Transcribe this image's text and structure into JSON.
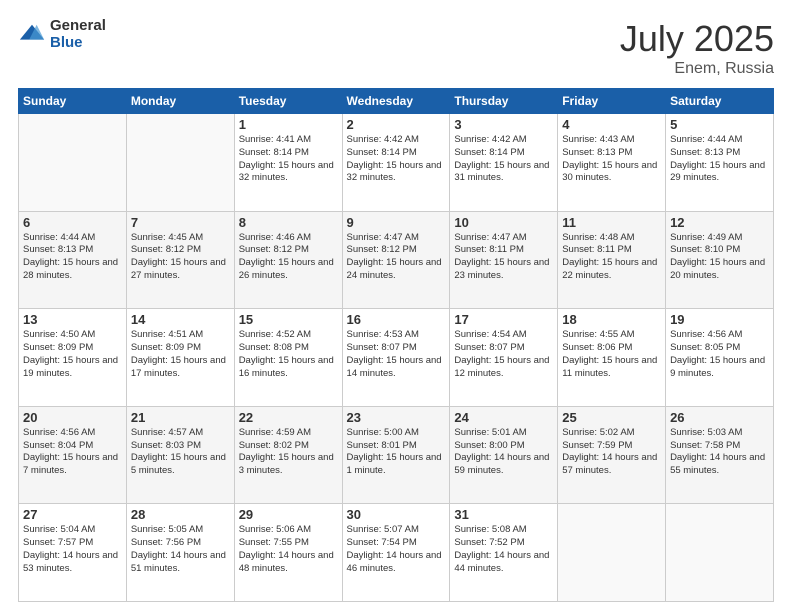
{
  "header": {
    "logo_general": "General",
    "logo_blue": "Blue",
    "month_title": "July 2025",
    "location": "Enem, Russia"
  },
  "weekdays": [
    "Sunday",
    "Monday",
    "Tuesday",
    "Wednesday",
    "Thursday",
    "Friday",
    "Saturday"
  ],
  "weeks": [
    [
      {
        "day": "",
        "info": ""
      },
      {
        "day": "",
        "info": ""
      },
      {
        "day": "1",
        "info": "Sunrise: 4:41 AM\nSunset: 8:14 PM\nDaylight: 15 hours\nand 32 minutes."
      },
      {
        "day": "2",
        "info": "Sunrise: 4:42 AM\nSunset: 8:14 PM\nDaylight: 15 hours\nand 32 minutes."
      },
      {
        "day": "3",
        "info": "Sunrise: 4:42 AM\nSunset: 8:14 PM\nDaylight: 15 hours\nand 31 minutes."
      },
      {
        "day": "4",
        "info": "Sunrise: 4:43 AM\nSunset: 8:13 PM\nDaylight: 15 hours\nand 30 minutes."
      },
      {
        "day": "5",
        "info": "Sunrise: 4:44 AM\nSunset: 8:13 PM\nDaylight: 15 hours\nand 29 minutes."
      }
    ],
    [
      {
        "day": "6",
        "info": "Sunrise: 4:44 AM\nSunset: 8:13 PM\nDaylight: 15 hours\nand 28 minutes."
      },
      {
        "day": "7",
        "info": "Sunrise: 4:45 AM\nSunset: 8:12 PM\nDaylight: 15 hours\nand 27 minutes."
      },
      {
        "day": "8",
        "info": "Sunrise: 4:46 AM\nSunset: 8:12 PM\nDaylight: 15 hours\nand 26 minutes."
      },
      {
        "day": "9",
        "info": "Sunrise: 4:47 AM\nSunset: 8:12 PM\nDaylight: 15 hours\nand 24 minutes."
      },
      {
        "day": "10",
        "info": "Sunrise: 4:47 AM\nSunset: 8:11 PM\nDaylight: 15 hours\nand 23 minutes."
      },
      {
        "day": "11",
        "info": "Sunrise: 4:48 AM\nSunset: 8:11 PM\nDaylight: 15 hours\nand 22 minutes."
      },
      {
        "day": "12",
        "info": "Sunrise: 4:49 AM\nSunset: 8:10 PM\nDaylight: 15 hours\nand 20 minutes."
      }
    ],
    [
      {
        "day": "13",
        "info": "Sunrise: 4:50 AM\nSunset: 8:09 PM\nDaylight: 15 hours\nand 19 minutes."
      },
      {
        "day": "14",
        "info": "Sunrise: 4:51 AM\nSunset: 8:09 PM\nDaylight: 15 hours\nand 17 minutes."
      },
      {
        "day": "15",
        "info": "Sunrise: 4:52 AM\nSunset: 8:08 PM\nDaylight: 15 hours\nand 16 minutes."
      },
      {
        "day": "16",
        "info": "Sunrise: 4:53 AM\nSunset: 8:07 PM\nDaylight: 15 hours\nand 14 minutes."
      },
      {
        "day": "17",
        "info": "Sunrise: 4:54 AM\nSunset: 8:07 PM\nDaylight: 15 hours\nand 12 minutes."
      },
      {
        "day": "18",
        "info": "Sunrise: 4:55 AM\nSunset: 8:06 PM\nDaylight: 15 hours\nand 11 minutes."
      },
      {
        "day": "19",
        "info": "Sunrise: 4:56 AM\nSunset: 8:05 PM\nDaylight: 15 hours\nand 9 minutes."
      }
    ],
    [
      {
        "day": "20",
        "info": "Sunrise: 4:56 AM\nSunset: 8:04 PM\nDaylight: 15 hours\nand 7 minutes."
      },
      {
        "day": "21",
        "info": "Sunrise: 4:57 AM\nSunset: 8:03 PM\nDaylight: 15 hours\nand 5 minutes."
      },
      {
        "day": "22",
        "info": "Sunrise: 4:59 AM\nSunset: 8:02 PM\nDaylight: 15 hours\nand 3 minutes."
      },
      {
        "day": "23",
        "info": "Sunrise: 5:00 AM\nSunset: 8:01 PM\nDaylight: 15 hours\nand 1 minute."
      },
      {
        "day": "24",
        "info": "Sunrise: 5:01 AM\nSunset: 8:00 PM\nDaylight: 14 hours\nand 59 minutes."
      },
      {
        "day": "25",
        "info": "Sunrise: 5:02 AM\nSunset: 7:59 PM\nDaylight: 14 hours\nand 57 minutes."
      },
      {
        "day": "26",
        "info": "Sunrise: 5:03 AM\nSunset: 7:58 PM\nDaylight: 14 hours\nand 55 minutes."
      }
    ],
    [
      {
        "day": "27",
        "info": "Sunrise: 5:04 AM\nSunset: 7:57 PM\nDaylight: 14 hours\nand 53 minutes."
      },
      {
        "day": "28",
        "info": "Sunrise: 5:05 AM\nSunset: 7:56 PM\nDaylight: 14 hours\nand 51 minutes."
      },
      {
        "day": "29",
        "info": "Sunrise: 5:06 AM\nSunset: 7:55 PM\nDaylight: 14 hours\nand 48 minutes."
      },
      {
        "day": "30",
        "info": "Sunrise: 5:07 AM\nSunset: 7:54 PM\nDaylight: 14 hours\nand 46 minutes."
      },
      {
        "day": "31",
        "info": "Sunrise: 5:08 AM\nSunset: 7:52 PM\nDaylight: 14 hours\nand 44 minutes."
      },
      {
        "day": "",
        "info": ""
      },
      {
        "day": "",
        "info": ""
      }
    ]
  ]
}
